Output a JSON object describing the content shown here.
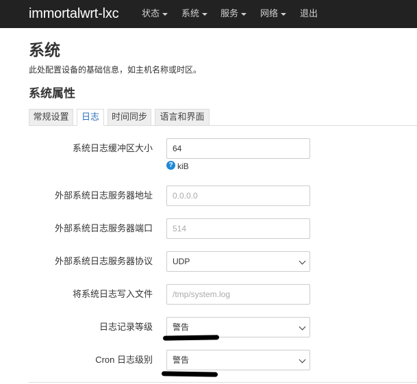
{
  "header": {
    "brand": "immortalwrt-lxc",
    "nav": [
      {
        "label": "状态",
        "dropdown": true
      },
      {
        "label": "系统",
        "dropdown": true
      },
      {
        "label": "服务",
        "dropdown": true
      },
      {
        "label": "网络",
        "dropdown": true
      },
      {
        "label": "退出",
        "dropdown": false
      }
    ]
  },
  "page": {
    "title": "系统",
    "description": "此处配置设备的基础信息，如主机名称或时区。",
    "section_title": "系统属性"
  },
  "tabs": [
    {
      "label": "常规设置",
      "active": false
    },
    {
      "label": "日志",
      "active": true
    },
    {
      "label": "时间同步",
      "active": false
    },
    {
      "label": "语言和界面",
      "active": false
    }
  ],
  "form": {
    "buffer_size": {
      "label": "系统日志缓冲区大小",
      "value": "64",
      "unit": "kiB",
      "help_icon": "question-circle-icon"
    },
    "remote_server": {
      "label": "外部系统日志服务器地址",
      "placeholder": "0.0.0.0"
    },
    "remote_port": {
      "label": "外部系统日志服务器端口",
      "placeholder": "514"
    },
    "remote_protocol": {
      "label": "外部系统日志服务器协议",
      "value": "UDP"
    },
    "log_file": {
      "label": "将系统日志写入文件",
      "placeholder": "/tmp/system.log"
    },
    "log_level": {
      "label": "日志记录等级",
      "value": "警告"
    },
    "cron_level": {
      "label": "Cron 日志级别",
      "value": "警告"
    }
  },
  "colors": {
    "navbar_bg": "#222222",
    "active_tab_text": "#2a6ebb",
    "help_icon": "#1e88d8",
    "annotation_mark": "#000000"
  }
}
